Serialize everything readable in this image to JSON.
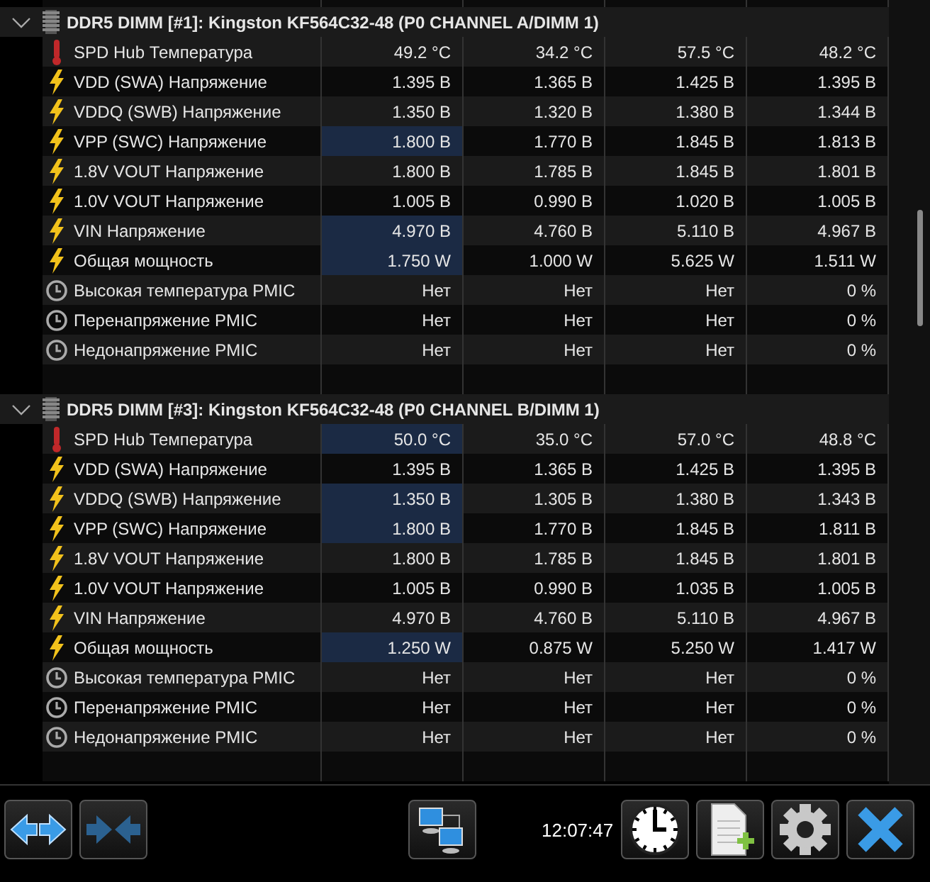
{
  "groups": [
    {
      "title": "DDR5 DIMM [#1]: Kingston KF564C32-48 (P0 CHANNEL A/DIMM 1)",
      "expanded": true,
      "sensors": [
        {
          "kind": "temperature",
          "name": "SPD Hub Температура",
          "values": [
            {
              "text": "49.2 °C",
              "highlighted": false
            },
            {
              "text": "34.2 °C",
              "highlighted": false
            },
            {
              "text": "57.5 °C",
              "highlighted": false
            },
            {
              "text": "48.2 °C",
              "highlighted": false
            }
          ]
        },
        {
          "kind": "voltage",
          "name": "VDD (SWA) Напряжение",
          "values": [
            {
              "text": "1.395 В",
              "highlighted": false
            },
            {
              "text": "1.365 В",
              "highlighted": false
            },
            {
              "text": "1.425 В",
              "highlighted": false
            },
            {
              "text": "1.395 В",
              "highlighted": false
            }
          ]
        },
        {
          "kind": "voltage",
          "name": "VDDQ (SWB) Напряжение",
          "values": [
            {
              "text": "1.350 В",
              "highlighted": false
            },
            {
              "text": "1.320 В",
              "highlighted": false
            },
            {
              "text": "1.380 В",
              "highlighted": false
            },
            {
              "text": "1.344 В",
              "highlighted": false
            }
          ]
        },
        {
          "kind": "voltage",
          "name": "VPP (SWC) Напряжение",
          "values": [
            {
              "text": "1.800 В",
              "highlighted": true
            },
            {
              "text": "1.770 В",
              "highlighted": false
            },
            {
              "text": "1.845 В",
              "highlighted": false
            },
            {
              "text": "1.813 В",
              "highlighted": false
            }
          ]
        },
        {
          "kind": "voltage",
          "name": "1.8V VOUT Напряжение",
          "values": [
            {
              "text": "1.800 В",
              "highlighted": false
            },
            {
              "text": "1.785 В",
              "highlighted": false
            },
            {
              "text": "1.845 В",
              "highlighted": false
            },
            {
              "text": "1.801 В",
              "highlighted": false
            }
          ]
        },
        {
          "kind": "voltage",
          "name": "1.0V VOUT Напряжение",
          "values": [
            {
              "text": "1.005 В",
              "highlighted": false
            },
            {
              "text": "0.990 В",
              "highlighted": false
            },
            {
              "text": "1.020 В",
              "highlighted": false
            },
            {
              "text": "1.005 В",
              "highlighted": false
            }
          ]
        },
        {
          "kind": "voltage",
          "name": "VIN Напряжение",
          "values": [
            {
              "text": "4.970 В",
              "highlighted": true
            },
            {
              "text": "4.760 В",
              "highlighted": false
            },
            {
              "text": "5.110 В",
              "highlighted": false
            },
            {
              "text": "4.967 В",
              "highlighted": false
            }
          ]
        },
        {
          "kind": "power",
          "name": "Общая мощность",
          "values": [
            {
              "text": "1.750 W",
              "highlighted": true
            },
            {
              "text": "1.000 W",
              "highlighted": false
            },
            {
              "text": "5.625 W",
              "highlighted": false
            },
            {
              "text": "1.511 W",
              "highlighted": false
            }
          ]
        },
        {
          "kind": "status",
          "name": "Высокая температура PMIC",
          "values": [
            {
              "text": "Нет",
              "highlighted": false
            },
            {
              "text": "Нет",
              "highlighted": false
            },
            {
              "text": "Нет",
              "highlighted": false
            },
            {
              "text": "0 %",
              "highlighted": false
            }
          ]
        },
        {
          "kind": "status",
          "name": "Перенапряжение PMIC",
          "values": [
            {
              "text": "Нет",
              "highlighted": false
            },
            {
              "text": "Нет",
              "highlighted": false
            },
            {
              "text": "Нет",
              "highlighted": false
            },
            {
              "text": "0 %",
              "highlighted": false
            }
          ]
        },
        {
          "kind": "status",
          "name": "Недонапряжение PMIC",
          "values": [
            {
              "text": "Нет",
              "highlighted": false
            },
            {
              "text": "Нет",
              "highlighted": false
            },
            {
              "text": "Нет",
              "highlighted": false
            },
            {
              "text": "0 %",
              "highlighted": false
            }
          ]
        }
      ]
    },
    {
      "title": "DDR5 DIMM [#3]: Kingston KF564C32-48 (P0 CHANNEL B/DIMM 1)",
      "expanded": true,
      "sensors": [
        {
          "kind": "temperature",
          "name": "SPD Hub Температура",
          "values": [
            {
              "text": "50.0 °C",
              "highlighted": true
            },
            {
              "text": "35.0 °C",
              "highlighted": false
            },
            {
              "text": "57.0 °C",
              "highlighted": false
            },
            {
              "text": "48.8 °C",
              "highlighted": false
            }
          ]
        },
        {
          "kind": "voltage",
          "name": "VDD (SWA) Напряжение",
          "values": [
            {
              "text": "1.395 В",
              "highlighted": false
            },
            {
              "text": "1.365 В",
              "highlighted": false
            },
            {
              "text": "1.425 В",
              "highlighted": false
            },
            {
              "text": "1.395 В",
              "highlighted": false
            }
          ]
        },
        {
          "kind": "voltage",
          "name": "VDDQ (SWB) Напряжение",
          "values": [
            {
              "text": "1.350 В",
              "highlighted": true
            },
            {
              "text": "1.305 В",
              "highlighted": false
            },
            {
              "text": "1.380 В",
              "highlighted": false
            },
            {
              "text": "1.343 В",
              "highlighted": false
            }
          ]
        },
        {
          "kind": "voltage",
          "name": "VPP (SWC) Напряжение",
          "values": [
            {
              "text": "1.800 В",
              "highlighted": true
            },
            {
              "text": "1.770 В",
              "highlighted": false
            },
            {
              "text": "1.845 В",
              "highlighted": false
            },
            {
              "text": "1.811 В",
              "highlighted": false
            }
          ]
        },
        {
          "kind": "voltage",
          "name": "1.8V VOUT Напряжение",
          "values": [
            {
              "text": "1.800 В",
              "highlighted": false
            },
            {
              "text": "1.785 В",
              "highlighted": false
            },
            {
              "text": "1.845 В",
              "highlighted": false
            },
            {
              "text": "1.801 В",
              "highlighted": false
            }
          ]
        },
        {
          "kind": "voltage",
          "name": "1.0V VOUT Напряжение",
          "values": [
            {
              "text": "1.005 В",
              "highlighted": false
            },
            {
              "text": "0.990 В",
              "highlighted": false
            },
            {
              "text": "1.035 В",
              "highlighted": false
            },
            {
              "text": "1.005 В",
              "highlighted": false
            }
          ]
        },
        {
          "kind": "voltage",
          "name": "VIN Напряжение",
          "values": [
            {
              "text": "4.970 В",
              "highlighted": false
            },
            {
              "text": "4.760 В",
              "highlighted": false
            },
            {
              "text": "5.110 В",
              "highlighted": false
            },
            {
              "text": "4.967 В",
              "highlighted": false
            }
          ]
        },
        {
          "kind": "power",
          "name": "Общая мощность",
          "values": [
            {
              "text": "1.250 W",
              "highlighted": true
            },
            {
              "text": "0.875 W",
              "highlighted": false
            },
            {
              "text": "5.250 W",
              "highlighted": false
            },
            {
              "text": "1.417 W",
              "highlighted": false
            }
          ]
        },
        {
          "kind": "status",
          "name": "Высокая температура PMIC",
          "values": [
            {
              "text": "Нет",
              "highlighted": false
            },
            {
              "text": "Нет",
              "highlighted": false
            },
            {
              "text": "Нет",
              "highlighted": false
            },
            {
              "text": "0 %",
              "highlighted": false
            }
          ]
        },
        {
          "kind": "status",
          "name": "Перенапряжение PMIC",
          "values": [
            {
              "text": "Нет",
              "highlighted": false
            },
            {
              "text": "Нет",
              "highlighted": false
            },
            {
              "text": "Нет",
              "highlighted": false
            },
            {
              "text": "0 %",
              "highlighted": false
            }
          ]
        },
        {
          "kind": "status",
          "name": "Недонапряжение PMIC",
          "values": [
            {
              "text": "Нет",
              "highlighted": false
            },
            {
              "text": "Нет",
              "highlighted": false
            },
            {
              "text": "Нет",
              "highlighted": false
            },
            {
              "text": "0 %",
              "highlighted": false
            }
          ]
        }
      ]
    }
  ],
  "toolbar": {
    "time": "12:07:47"
  }
}
